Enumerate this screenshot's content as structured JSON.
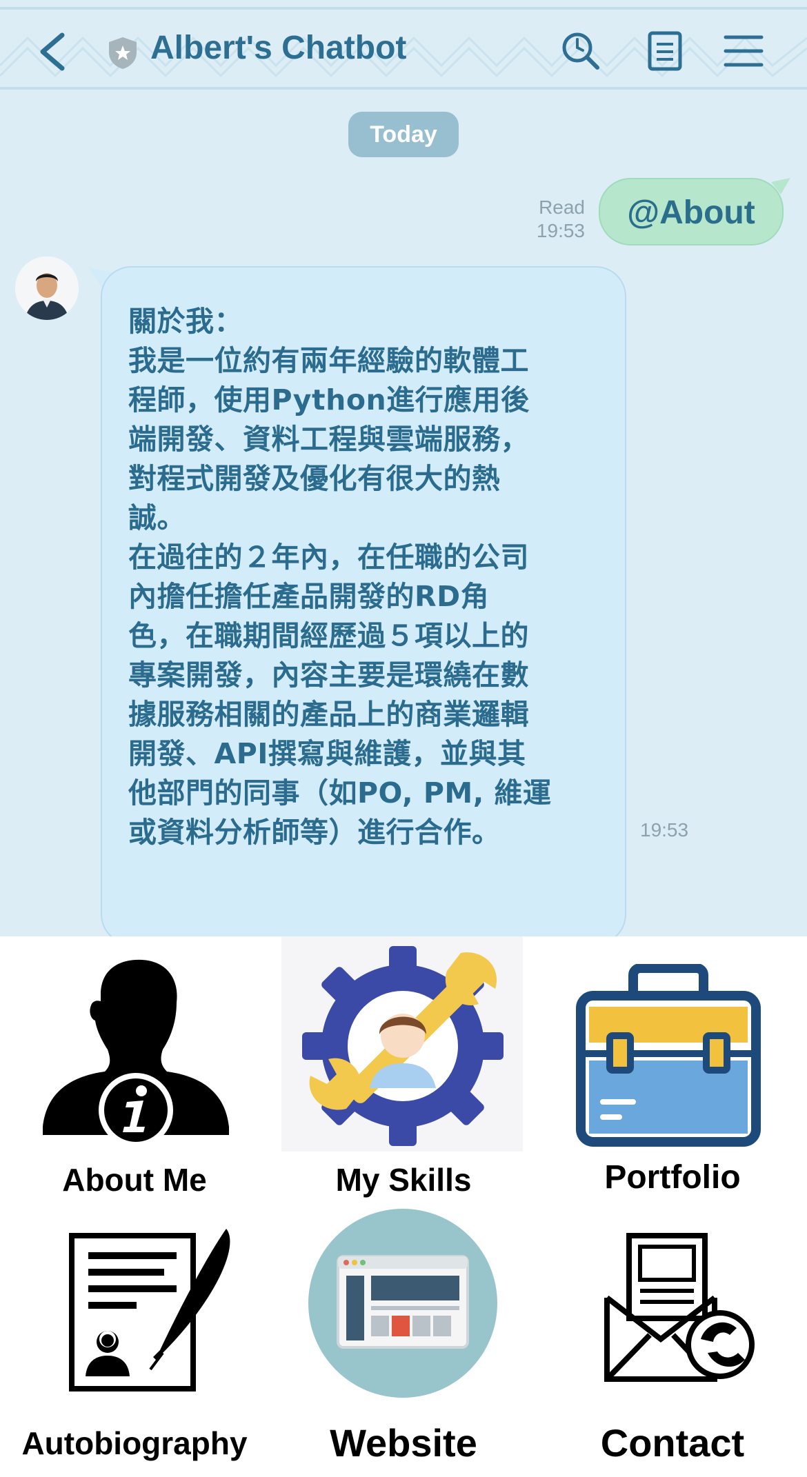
{
  "header": {
    "title": "Albert's Chatbot",
    "icons": [
      "back-chevron-icon",
      "shield-star-icon",
      "search-clock-icon",
      "notes-icon",
      "menu-icon"
    ],
    "accent_color": "#2d6f92"
  },
  "chat": {
    "day_label": "Today",
    "sent_message": {
      "text": "@About",
      "status": "Read",
      "time": "19:53"
    },
    "received_message": {
      "lines": [
        "關於我：",
        "我是一位約有兩年經驗的軟體工",
        "程師，使用Python進行應用後",
        "端開發、資料工程與雲端服務，",
        "對程式開發及優化有很大的熱",
        "誠。",
        "在過往的２年內，在任職的公司",
        "內擔任擔任產品開發的RD角",
        "色，在職期間經歷過５項以上的",
        "專案開發，內容主要是環繞在數",
        "據服務相關的產品上的商業邏輯",
        "開發、API撰寫與維護，並與其",
        "他部門的同事（如PO, PM, 維運",
        "或資料分析師等）進行合作。"
      ],
      "time": "19:53"
    }
  },
  "rich_menu": {
    "items": [
      {
        "label": "About Me",
        "icon": "person-info-icon"
      },
      {
        "label": "My Skills",
        "icon": "gear-wrench-person-icon"
      },
      {
        "label": "Portfolio",
        "icon": "briefcase-icon"
      },
      {
        "label": "Autobiography",
        "icon": "document-quill-icon"
      },
      {
        "label": "Website",
        "icon": "browser-window-icon"
      },
      {
        "label": "Contact",
        "icon": "mail-phone-icon"
      }
    ]
  }
}
